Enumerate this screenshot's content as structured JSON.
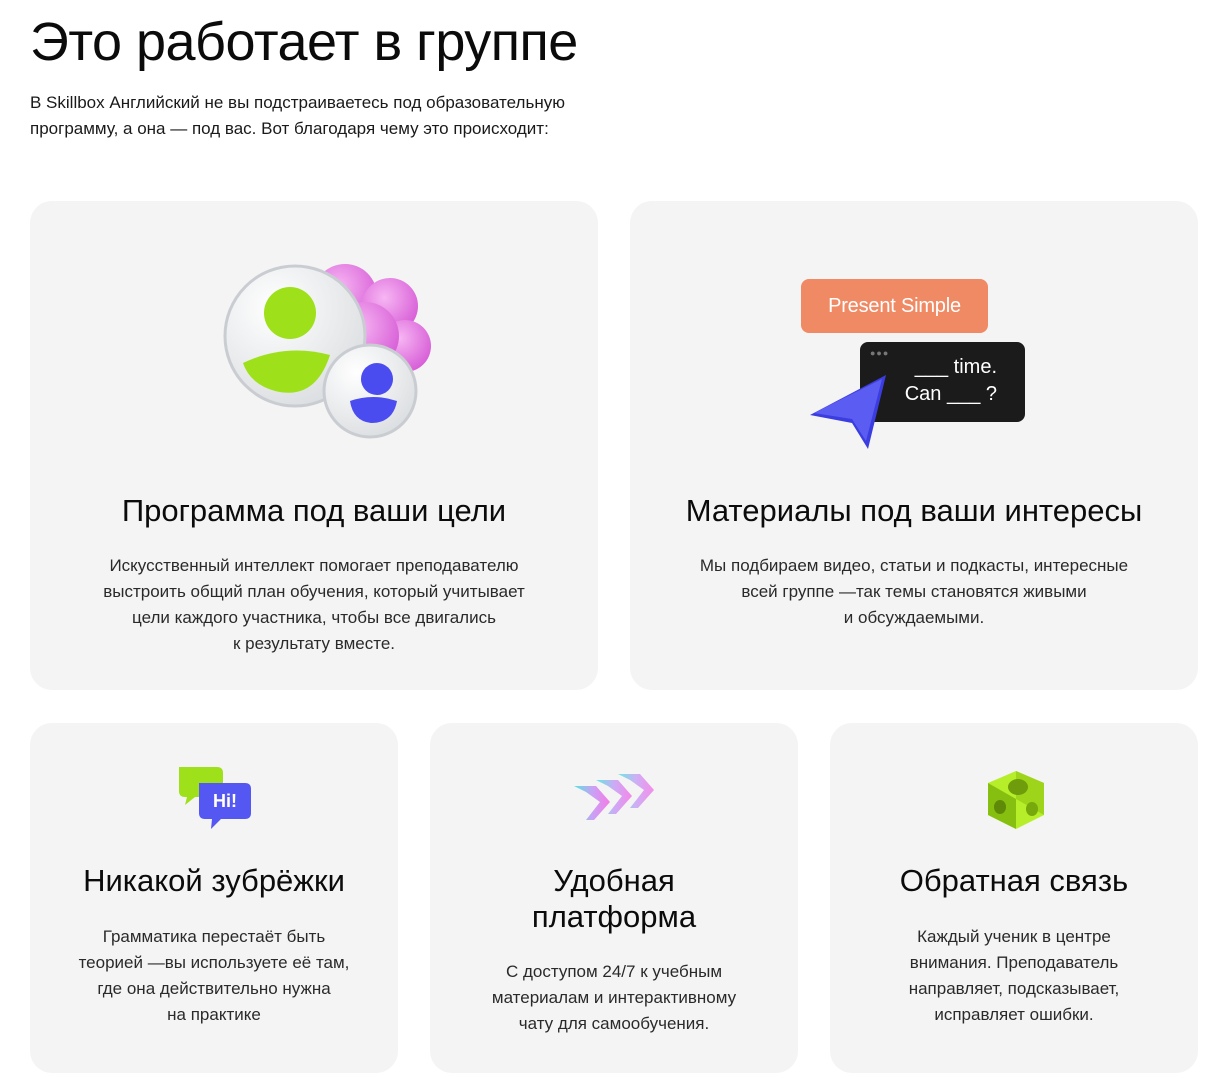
{
  "heading": "Это работает в группе",
  "intro": "В Skillbox Английский не вы подстраиваетесь под образовательную программу, а она — под вас. Вот благодаря чему это происходит:",
  "cards": [
    {
      "title": "Программа под ваши цели",
      "text_lines": [
        "Искусственный интеллект помогает преподавателю",
        "выстроить общий план обучения, который учитывает",
        "цели каждого участника, чтобы все двигались",
        "к результату вместе."
      ],
      "icon": "group-people-icon"
    },
    {
      "title": "Материалы под ваши интересы",
      "text_lines": [
        "Мы подбираем видео, статьи и подкасты, интересные",
        "всей группе —так темы становятся живыми",
        "и обсуждаемыми."
      ],
      "icon": "lesson-materials-icon",
      "pill_label": "Present Simple",
      "exercise_line_1": "___ time.",
      "exercise_line_2": "Can ___ ?"
    },
    {
      "title": "Никакой зубрёжки",
      "text_lines": [
        "Грамматика перестаёт быть",
        "теорией —вы используете её там,",
        "где она действительно нужна",
        "на практике"
      ],
      "icon": "chat-bubbles-icon",
      "bubble_text": "Hi!"
    },
    {
      "title_lines": [
        "Удобная",
        "платформа"
      ],
      "text_lines": [
        "С доступом 24/7 к учебным",
        "материалам и интерактивному",
        "чату для самообучения."
      ],
      "icon": "forward-arrows-icon"
    },
    {
      "title": "Обратная связь",
      "text_lines": [
        "Каждый ученик в центре",
        "внимания. Преподаватель",
        "направляет, подсказывает,",
        "исправляет ошибки."
      ],
      "icon": "cube-icon"
    }
  ],
  "colors": {
    "card_bg": "#f4f4f4",
    "pill_orange": "#f08a64",
    "lime": "#9ee01a",
    "violet": "#4b4cf0",
    "pink": "#e77be6"
  }
}
